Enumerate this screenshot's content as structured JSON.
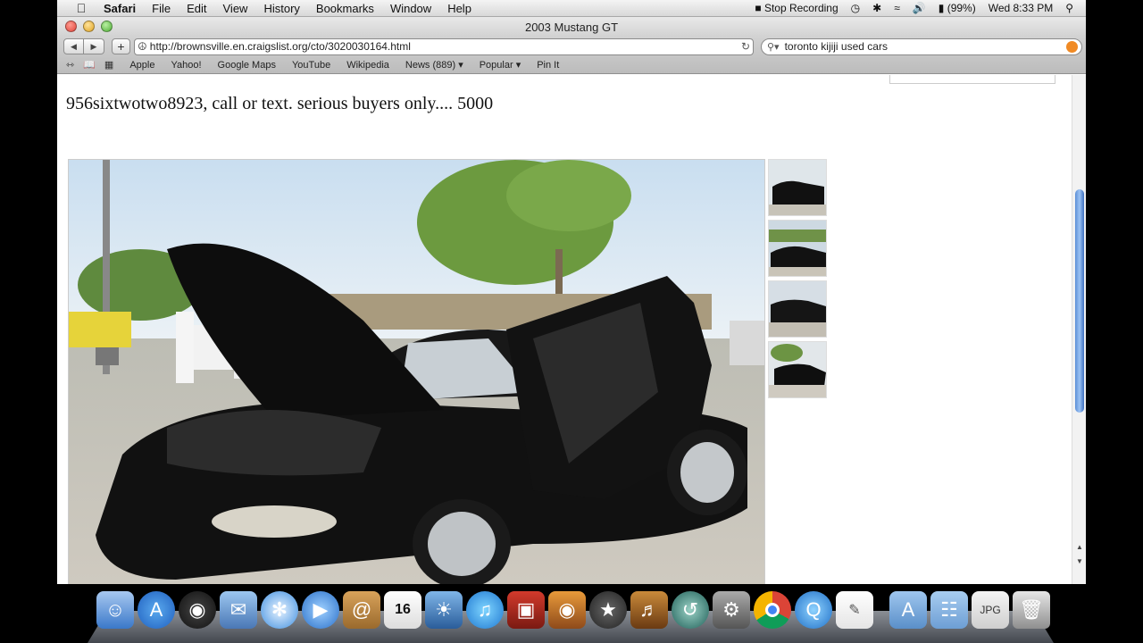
{
  "menubar": {
    "app": "Safari",
    "items": [
      "File",
      "Edit",
      "View",
      "History",
      "Bookmarks",
      "Window",
      "Help"
    ],
    "status": {
      "recording": "Stop Recording",
      "battery": "(99%)",
      "clock": "Wed 8:33 PM"
    }
  },
  "window": {
    "title": "2003 Mustang GT"
  },
  "toolbar": {
    "url": "http://brownsville.en.craigslist.org/cto/3020030164.html",
    "search": "toronto kijiji used cars"
  },
  "bookmarks": [
    "Apple",
    "Yahoo!",
    "Google Maps",
    "YouTube",
    "Wikipedia",
    "News (889) ▾",
    "Popular ▾",
    "Pin It"
  ],
  "post": {
    "text": "956sixtwotwo8923, call or text. serious buyers only.... 5000"
  },
  "dock": {
    "calendar_day": "16"
  },
  "icons": {
    "apple": "apple-logo-icon",
    "wifi": "wifi-icon",
    "bluetooth": "bluetooth-icon",
    "volume": "volume-icon",
    "spotlight": "spotlight-icon"
  }
}
